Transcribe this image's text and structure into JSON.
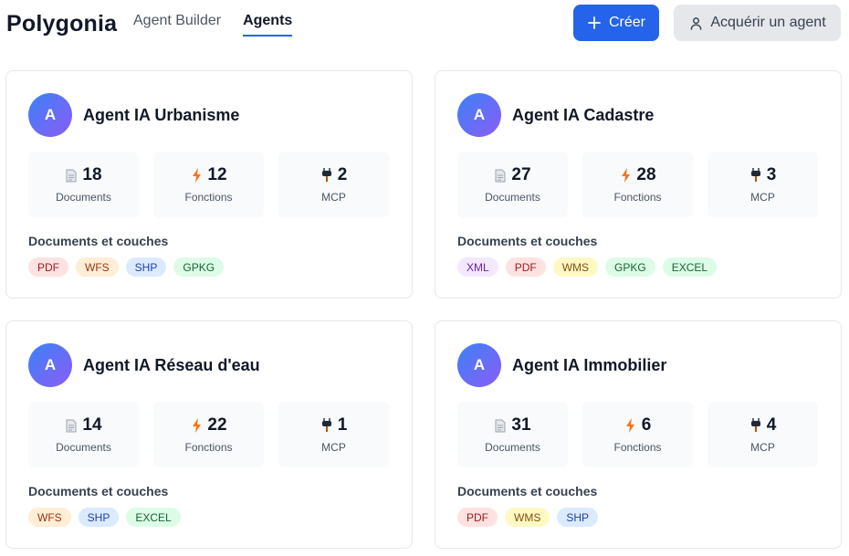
{
  "brand": "Polygonia",
  "nav": {
    "tabs": [
      "Agent Builder",
      "Agents"
    ],
    "active": "Agents"
  },
  "actions": {
    "create_label": "Créer",
    "acquire_label": "Acquérir un agent"
  },
  "labels": {
    "documents": "Documents",
    "fonctions": "Fonctions",
    "mcp": "MCP",
    "layers_title": "Documents et couches"
  },
  "agents": [
    {
      "avatar": "A",
      "name": "Agent IA Urbanisme",
      "documents": "18",
      "fonctions": "12",
      "mcp": "2",
      "tags": [
        "PDF",
        "WFS",
        "SHP",
        "GPKG"
      ]
    },
    {
      "avatar": "A",
      "name": "Agent IA Cadastre",
      "documents": "27",
      "fonctions": "28",
      "mcp": "3",
      "tags": [
        "XML",
        "PDF",
        "WMS",
        "GPKG",
        "EXCEL"
      ]
    },
    {
      "avatar": "A",
      "name": "Agent IA Réseau d'eau",
      "documents": "14",
      "fonctions": "22",
      "mcp": "1",
      "tags": [
        "WFS",
        "SHP",
        "EXCEL"
      ]
    },
    {
      "avatar": "A",
      "name": "Agent IA Immobilier",
      "documents": "31",
      "fonctions": "6",
      "mcp": "4",
      "tags": [
        "PDF",
        "WMS",
        "SHP"
      ]
    }
  ],
  "colors": {
    "primary": "#2563eb",
    "avatar_gradient_start": "#3b82f6",
    "avatar_gradient_end": "#8b5cf6"
  },
  "icons": {
    "documents": "document-icon",
    "fonctions": "lightning-icon",
    "mcp": "plug-icon",
    "create": "plus-icon",
    "acquire": "user-icon"
  }
}
